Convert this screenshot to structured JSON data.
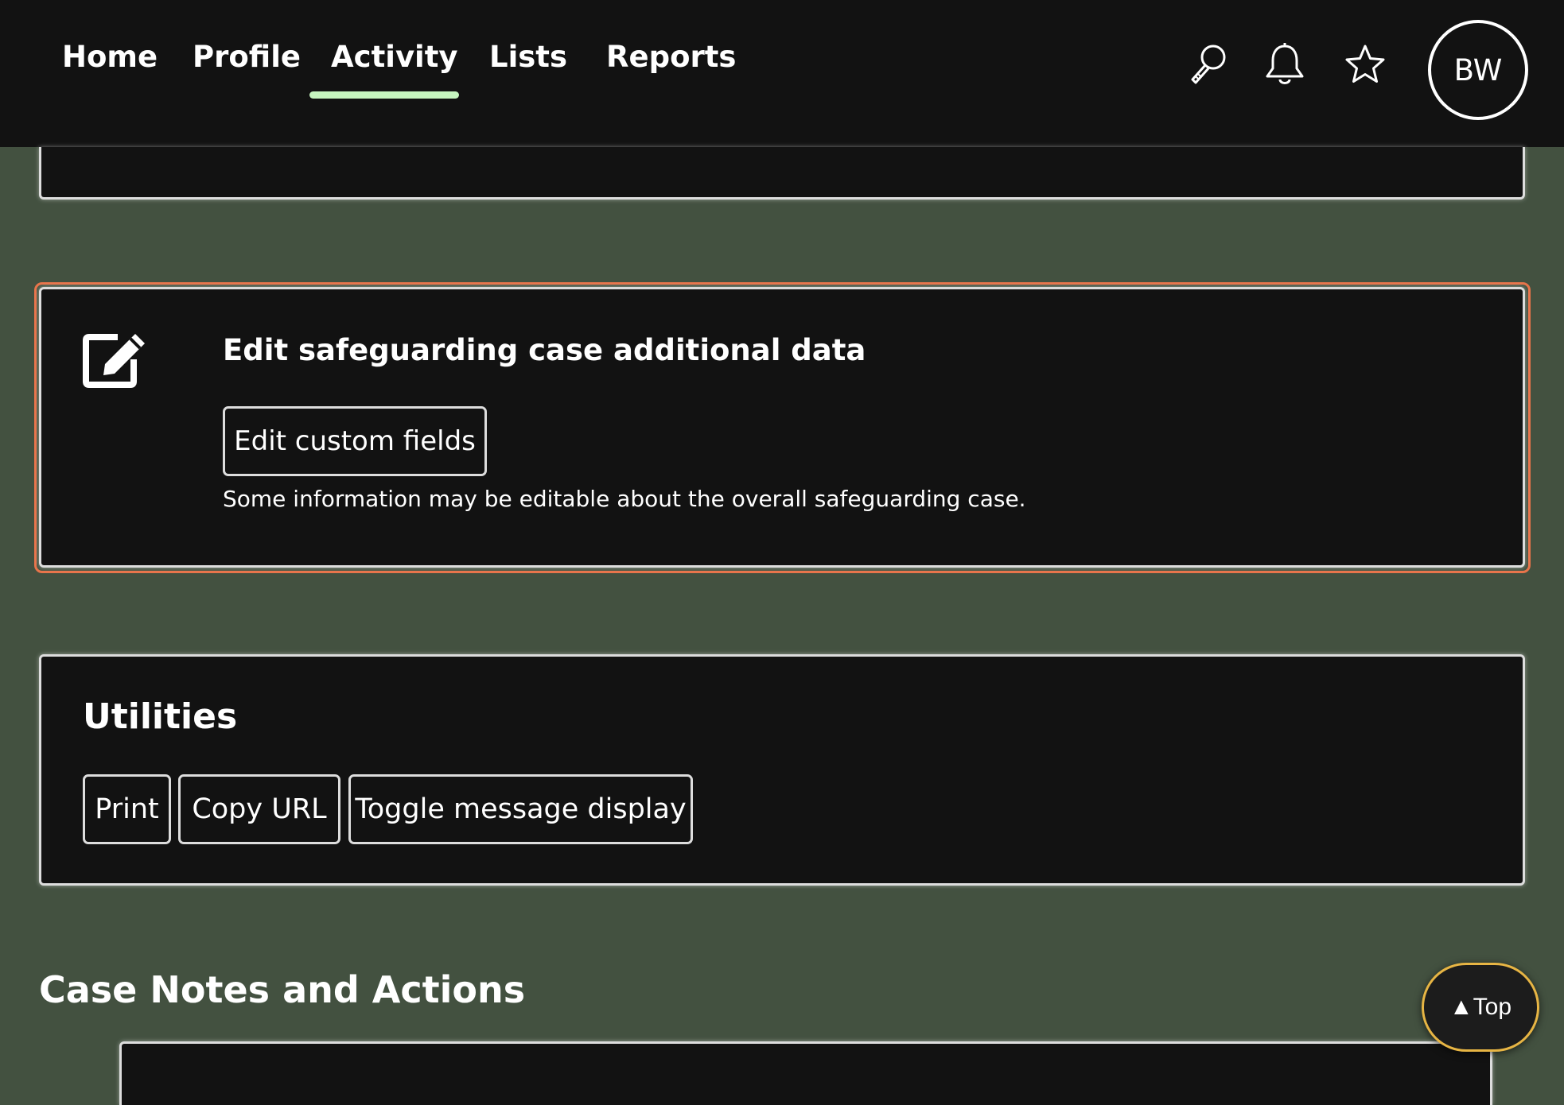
{
  "nav": {
    "items": [
      {
        "label": "Home"
      },
      {
        "label": "Profile"
      },
      {
        "label": "Activity",
        "active": true
      },
      {
        "label": "Lists"
      },
      {
        "label": "Reports"
      }
    ],
    "icons": [
      "search-icon",
      "bell-icon",
      "star-icon"
    ],
    "avatar_initials": "BW",
    "active_underline_color": "#c6f5bf"
  },
  "edit_panel": {
    "icon": "edit-icon",
    "title": "Edit safeguarding case additional data",
    "button_label": "Edit custom fields",
    "description": "Some information may be editable about the overall safeguarding case.",
    "focus_color": "#e8744a"
  },
  "utilities": {
    "title": "Utilities",
    "buttons": [
      {
        "label": "Print"
      },
      {
        "label": "Copy URL"
      },
      {
        "label": "Toggle message display"
      }
    ]
  },
  "case_notes": {
    "heading": "Case Notes and Actions"
  },
  "back_to_top": {
    "label": "▲Top",
    "border_color": "#e7b544"
  },
  "colors": {
    "page_background": "#435140",
    "panel_background": "#121212",
    "topbar_background": "#121212"
  }
}
